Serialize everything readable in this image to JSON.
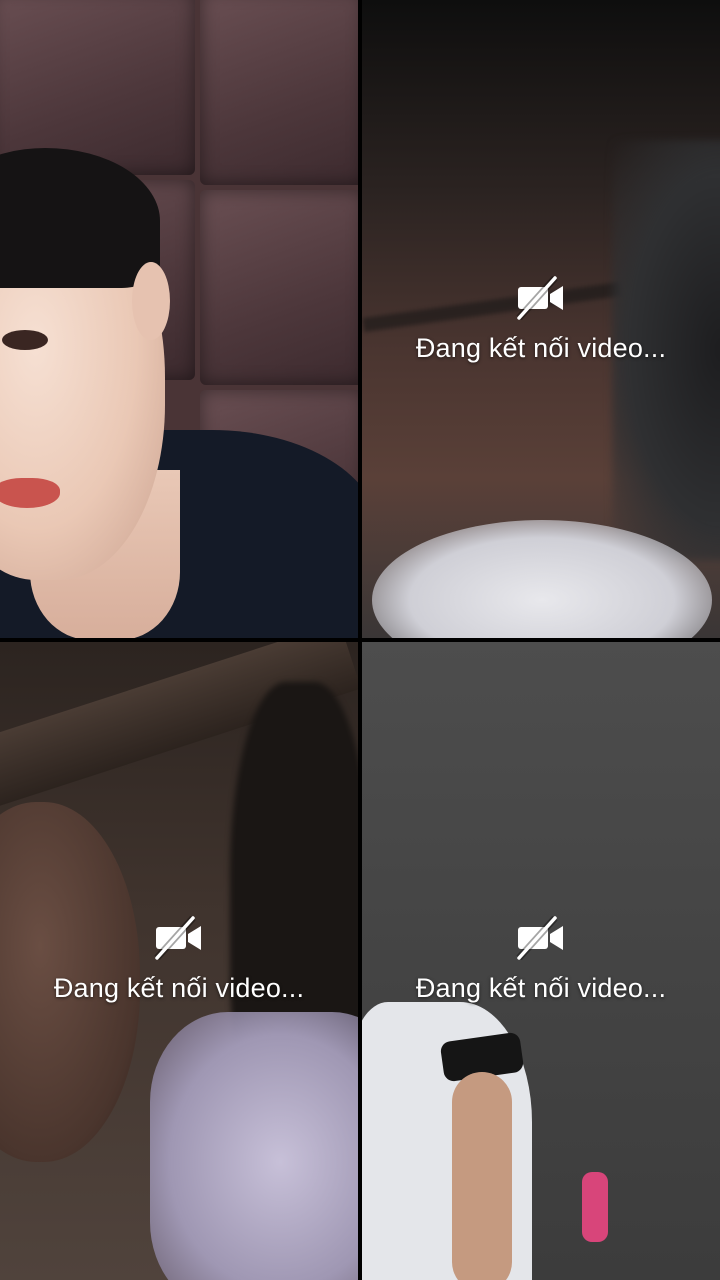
{
  "participants": [
    {
      "id": "p1",
      "status_text": "",
      "video_on": true
    },
    {
      "id": "p2",
      "status_text": "Đang kết nối video...",
      "video_on": false,
      "icon": "video-off-icon"
    },
    {
      "id": "p3",
      "status_text": "Đang kết nối video...",
      "video_on": false,
      "icon": "video-off-icon"
    },
    {
      "id": "p4",
      "status_text": "Đang kết nối video...",
      "video_on": false,
      "icon": "video-off-icon"
    }
  ],
  "colors": {
    "overlay_text": "#ffffff",
    "divider": "#000000"
  }
}
